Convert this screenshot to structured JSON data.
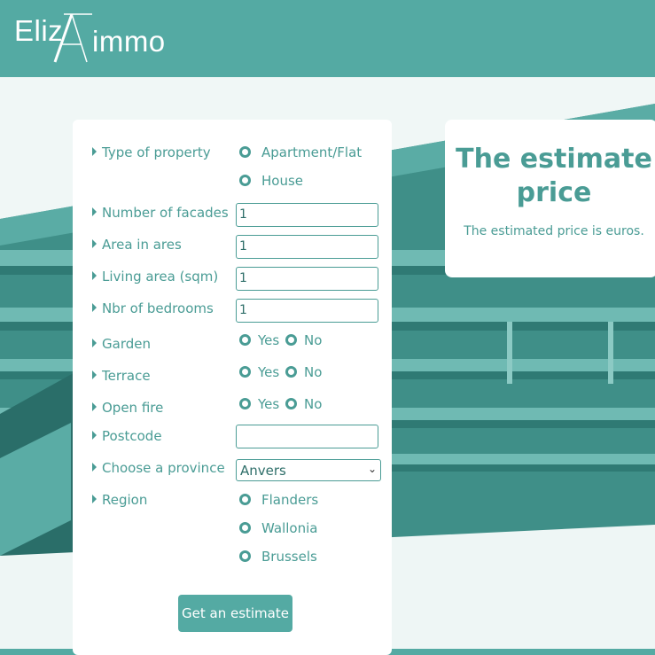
{
  "header": {
    "logo_left": "Eliz",
    "logo_a": "A",
    "logo_right": "immo"
  },
  "form": {
    "type_of_property": {
      "label": "Type of property",
      "options": [
        "Apartment/Flat",
        "House"
      ]
    },
    "facades": {
      "label": "Number of facades",
      "value": "1"
    },
    "area": {
      "label": "Area in ares",
      "value": "1"
    },
    "living_area": {
      "label": "Living area (sqm)",
      "value": "1"
    },
    "bedrooms": {
      "label": "Nbr of bedrooms",
      "value": "1"
    },
    "garden": {
      "label": "Garden",
      "yes": "Yes",
      "no": "No"
    },
    "terrace": {
      "label": "Terrace",
      "yes": "Yes",
      "no": "No"
    },
    "open_fire": {
      "label": "Open fire",
      "yes": "Yes",
      "no": "No"
    },
    "postcode": {
      "label": "Postcode",
      "value": ""
    },
    "province": {
      "label": "Choose a province",
      "selected": "Anvers"
    },
    "region": {
      "label": "Region",
      "options": [
        "Flanders",
        "Wallonia",
        "Brussels"
      ]
    },
    "submit_label": "Get an estimate"
  },
  "result": {
    "title": "The estimate price",
    "text": "The estimated price is euros."
  },
  "colors": {
    "accent": "#54aaa3",
    "text": "#4a9c95"
  }
}
